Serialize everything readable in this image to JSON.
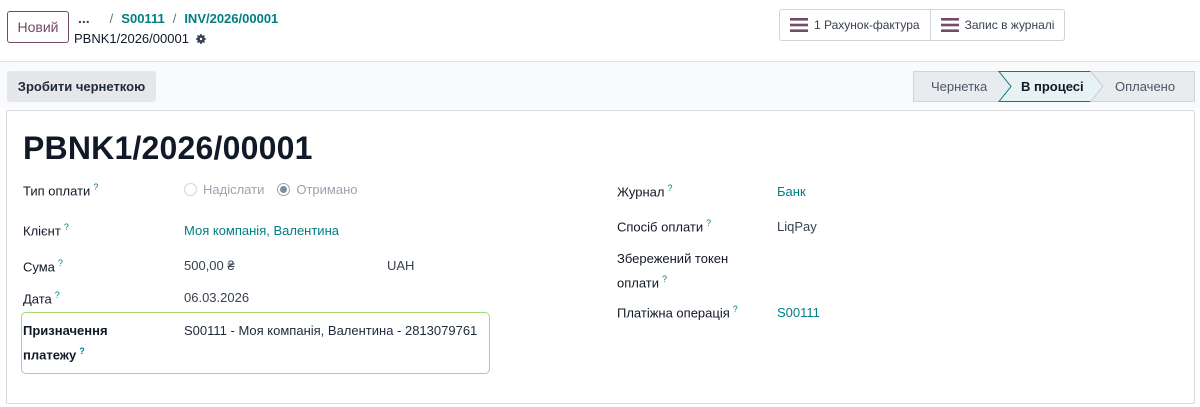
{
  "header": {
    "new_button": "Новий",
    "breadcrumb_more": "...",
    "breadcrumb_sep": "/",
    "breadcrumb_1": "S00111",
    "breadcrumb_2": "INV/2026/00001",
    "record_name": "PBNK1/2026/00001"
  },
  "smart_buttons": {
    "invoice": "1 Рахунок-фактура",
    "journal_entry": "Запис в журналі"
  },
  "statusbar": {
    "draft_button": "Зробити чернеткою",
    "stages": [
      "Чернетка",
      "В процесі",
      "Оплачено"
    ],
    "active_stage": "В процесі"
  },
  "form": {
    "title": "PBNK1/2026/00001",
    "help_mark": "?",
    "payment_type_label": "Тип оплати",
    "payment_type_options": [
      "Надіслати",
      "Отримано"
    ],
    "payment_type_selected": "Отримано",
    "customer_label": "Клієнт",
    "customer_value": "Моя компанія, Валентина",
    "amount_label": "Сума",
    "amount_value": "500,00 ₴",
    "currency_value": "UAH",
    "date_label": "Дата",
    "date_value": "06.03.2026",
    "memo_label_1": "Призначення",
    "memo_label_2": "платежу",
    "memo_value": "S00111 - Моя компанія, Валентина - 2813079761",
    "journal_label": "Журнал",
    "journal_value": "Банк",
    "method_label": "Спосіб оплати",
    "method_value": "LiqPay",
    "token_label_1": "Збережений токен",
    "token_label_2": "оплати",
    "transaction_label": "Платіжна операція",
    "transaction_value": "S00111"
  },
  "colors": {
    "brand": "#714b67",
    "link": "#017e84",
    "active_stage_bg": "#e6f2f3",
    "memo_border": "#a3d977"
  }
}
